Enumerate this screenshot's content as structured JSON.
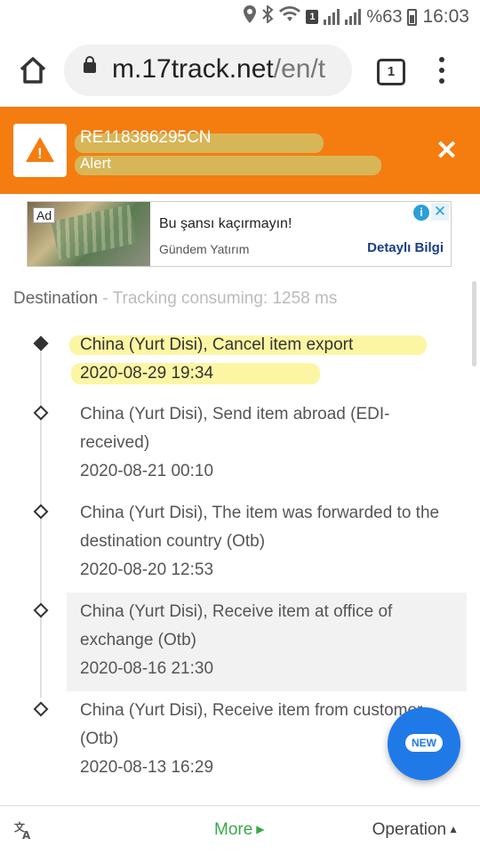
{
  "status_bar": {
    "battery_text": "%63",
    "time": "16:03",
    "sim_label": "1"
  },
  "browser": {
    "url_domain": "m.17track.net",
    "url_path": "/en/t",
    "tab_count": "1"
  },
  "alert": {
    "tracking_number": "RE118386295CN",
    "status": "Alert",
    "icon": "warning-triangle-icon",
    "color": "#f57c0f"
  },
  "ad": {
    "tag": "Ad",
    "title": "Bu şansı kaçırmayın!",
    "sponsor": "Gündem Yatırım",
    "cta": "Detaylı Bilgi"
  },
  "destination": {
    "label": "Destination",
    "separator": " - ",
    "meta": "Tracking consuming: 1258 ms"
  },
  "events": [
    {
      "desc": "China (Yurt Disi), Cancel item export",
      "time": "2020-08-29 19:34"
    },
    {
      "desc": "China (Yurt Disi), Send item abroad (EDI-received)",
      "time": "2020-08-21 00:10"
    },
    {
      "desc": "China (Yurt Disi), The item was forwarded to the destination country (Otb)",
      "time": "2020-08-20 12:53"
    },
    {
      "desc": "China (Yurt Disi), Receive item at office of exchange (Otb)",
      "time": "2020-08-16 21:30"
    },
    {
      "desc": "China (Yurt Disi), Receive item from customer (Otb)",
      "time": "2020-08-13 16:29"
    }
  ],
  "fab": {
    "label": "NEW"
  },
  "bottom_bar": {
    "translate_icon": "translate-icon",
    "more": "More",
    "operation": "Operation"
  }
}
